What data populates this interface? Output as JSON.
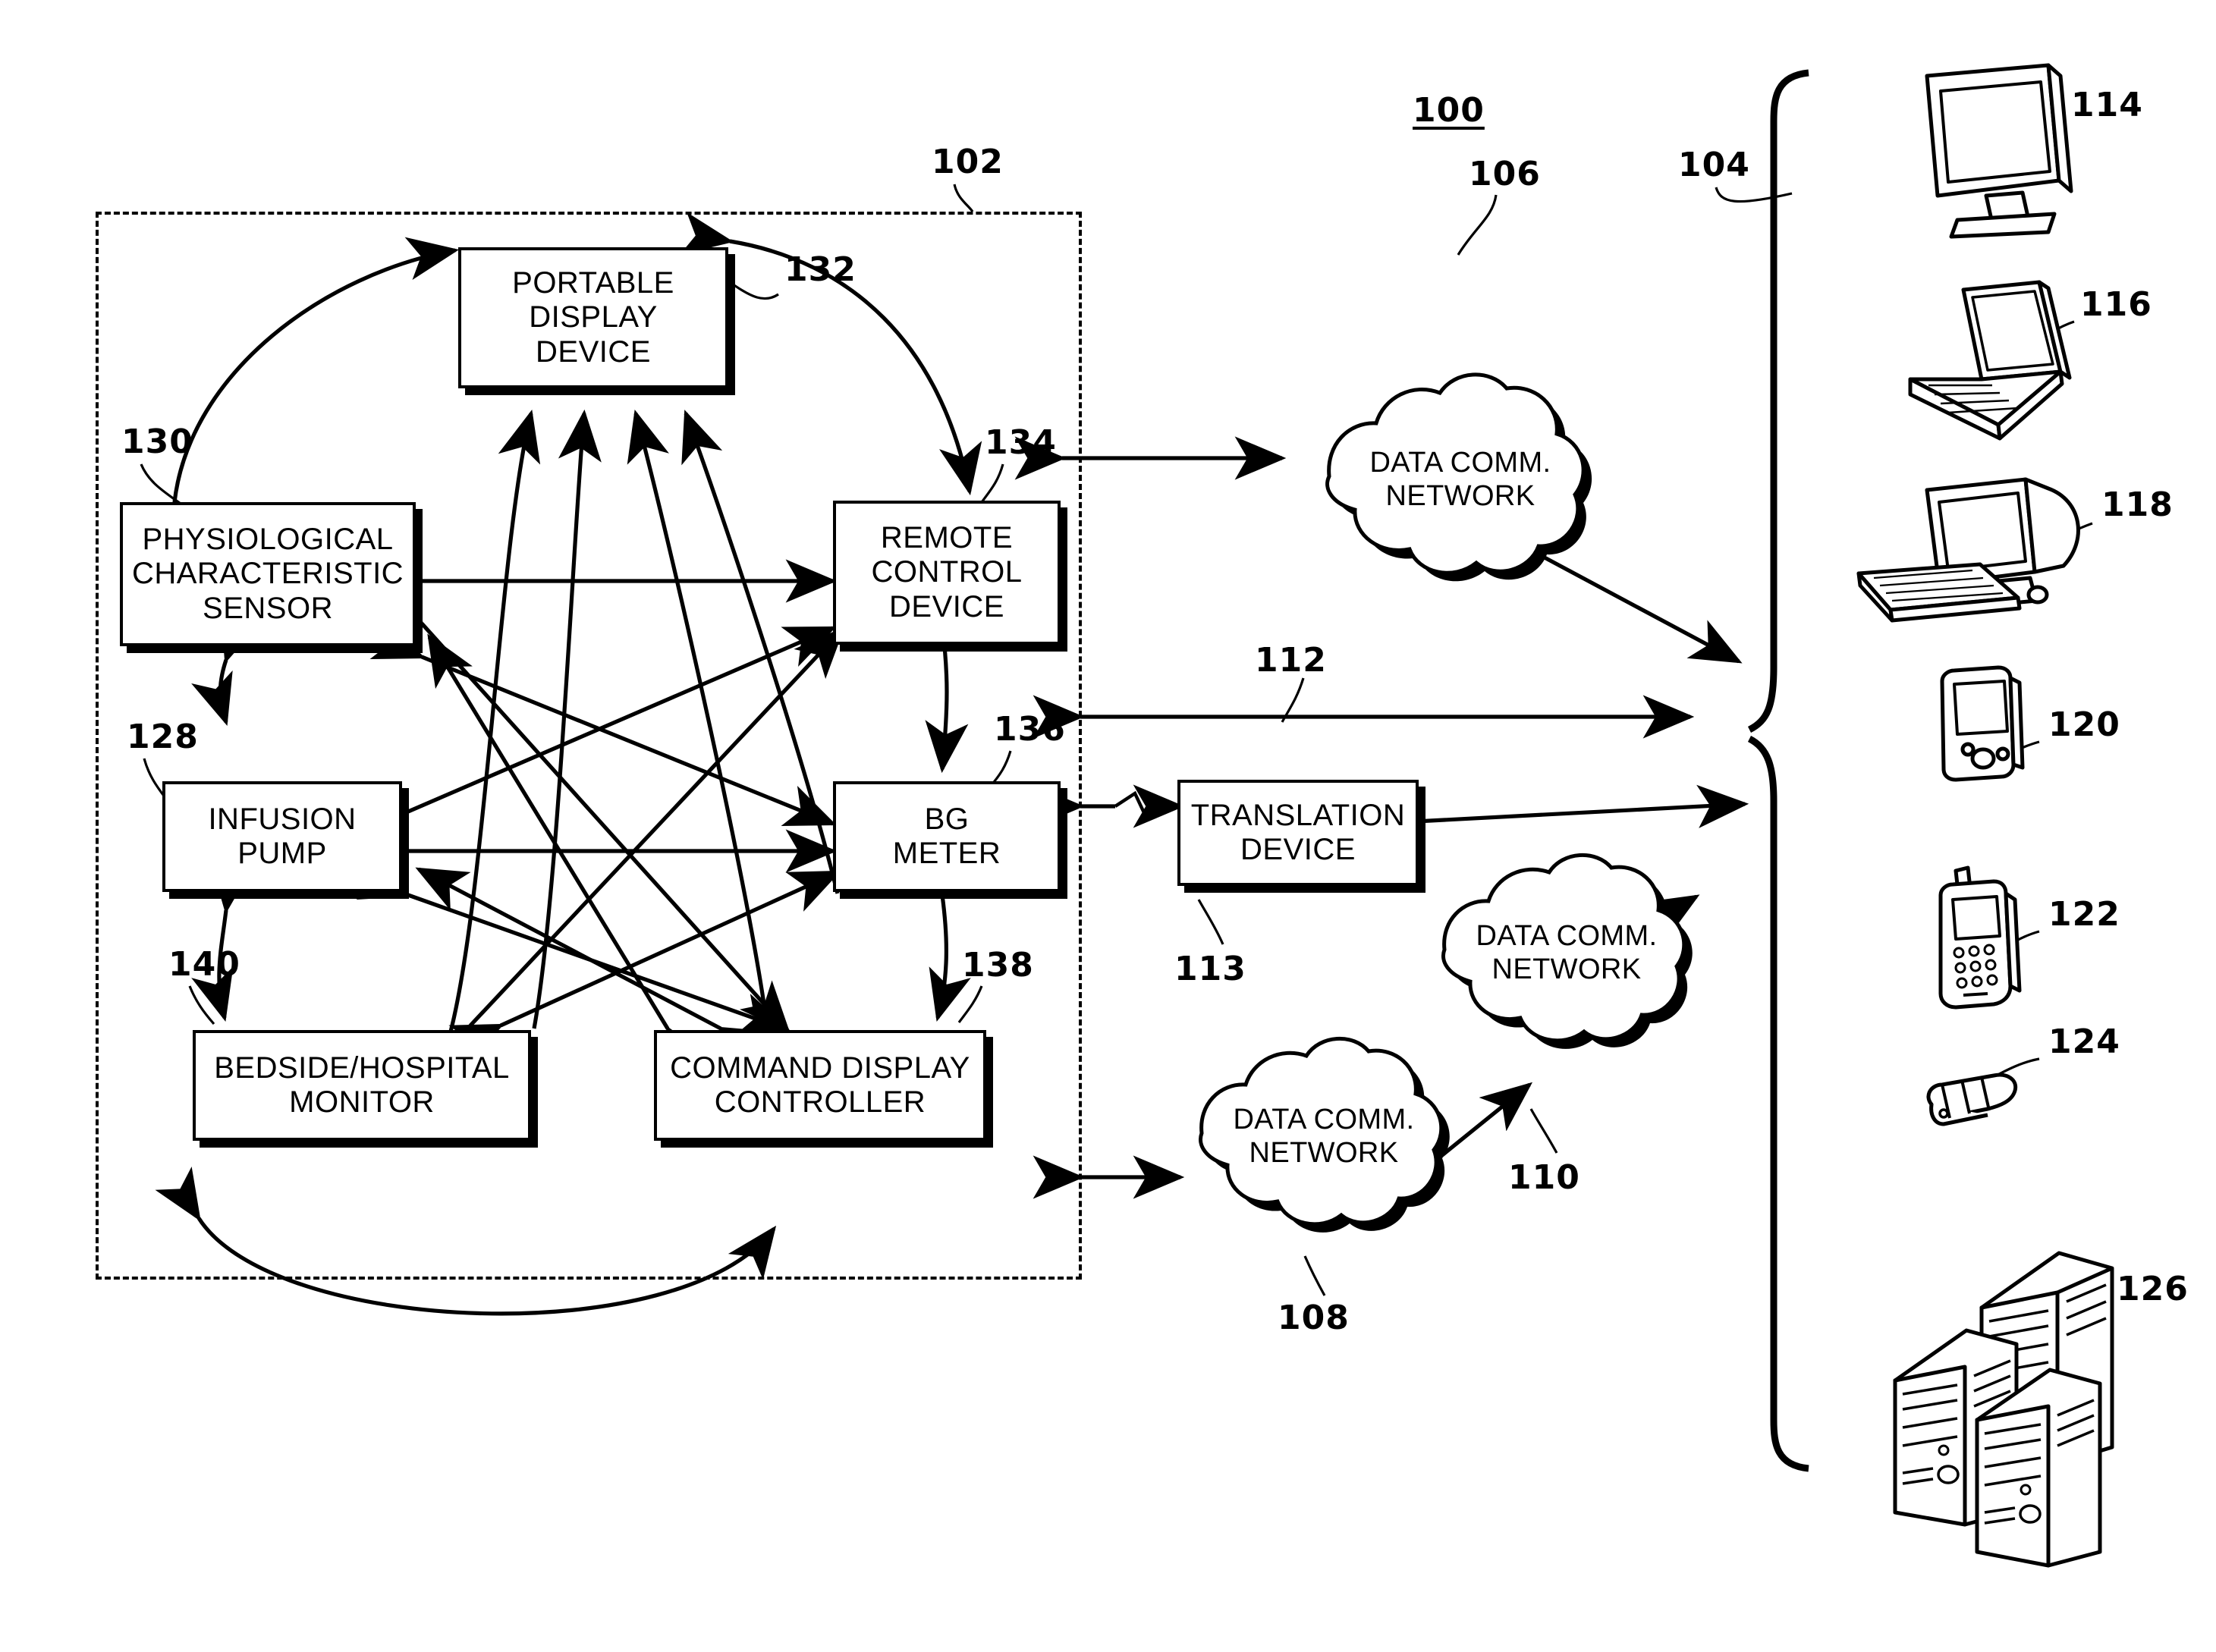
{
  "figure": {
    "system_ref": "100",
    "domain_ref_left": "102",
    "domain_ref_right": "104",
    "link_ref": "112"
  },
  "boundary": {
    "name": "local-device-domain",
    "ref": "102"
  },
  "nodes": [
    {
      "id": "portable-display-device",
      "ref": "132",
      "lines": [
        "PORTABLE",
        "DISPLAY",
        "DEVICE"
      ]
    },
    {
      "id": "physiological-characteristic-sensor",
      "ref": "130",
      "lines": [
        "PHYSIOLOGICAL",
        "CHARACTERISTIC",
        "SENSOR"
      ]
    },
    {
      "id": "remote-control-device",
      "ref": "134",
      "lines": [
        "REMOTE",
        "CONTROL",
        "DEVICE"
      ]
    },
    {
      "id": "infusion-pump",
      "ref": "128",
      "lines": [
        "INFUSION",
        "PUMP"
      ]
    },
    {
      "id": "bg-meter",
      "ref": "136",
      "lines": [
        "BG",
        "METER"
      ]
    },
    {
      "id": "bedside-hospital-monitor",
      "ref": "140",
      "lines": [
        "BEDSIDE/HOSPITAL",
        "MONITOR"
      ]
    },
    {
      "id": "command-display-controller",
      "ref": "138",
      "lines": [
        "COMMAND DISPLAY",
        "CONTROLLER"
      ]
    },
    {
      "id": "translation-device",
      "ref": "113",
      "lines": [
        "TRANSLATION",
        "DEVICE"
      ]
    }
  ],
  "clouds": [
    {
      "id": "data-comm-network-106",
      "ref": "106",
      "lines": [
        "DATA COMM.",
        "NETWORK"
      ]
    },
    {
      "id": "data-comm-network-110",
      "ref": "110",
      "lines": [
        "DATA COMM.",
        "NETWORK"
      ]
    },
    {
      "id": "data-comm-network-108",
      "ref": "108",
      "lines": [
        "DATA COMM.",
        "NETWORK"
      ]
    }
  ],
  "remote_devices": [
    {
      "id": "flat-panel-monitor",
      "ref": "114",
      "icon": "monitor-icon"
    },
    {
      "id": "laptop-computer",
      "ref": "116",
      "icon": "laptop-icon"
    },
    {
      "id": "desktop-computer",
      "ref": "118",
      "icon": "desktop-computer-icon"
    },
    {
      "id": "pda-device",
      "ref": "120",
      "icon": "pda-icon"
    },
    {
      "id": "mobile-phone",
      "ref": "122",
      "icon": "mobile-phone-icon"
    },
    {
      "id": "flip-phone",
      "ref": "124",
      "icon": "flip-phone-icon"
    },
    {
      "id": "server-stack",
      "ref": "126",
      "icon": "servers-icon"
    }
  ],
  "colors": {
    "ink": "#000000",
    "paper": "#ffffff"
  }
}
